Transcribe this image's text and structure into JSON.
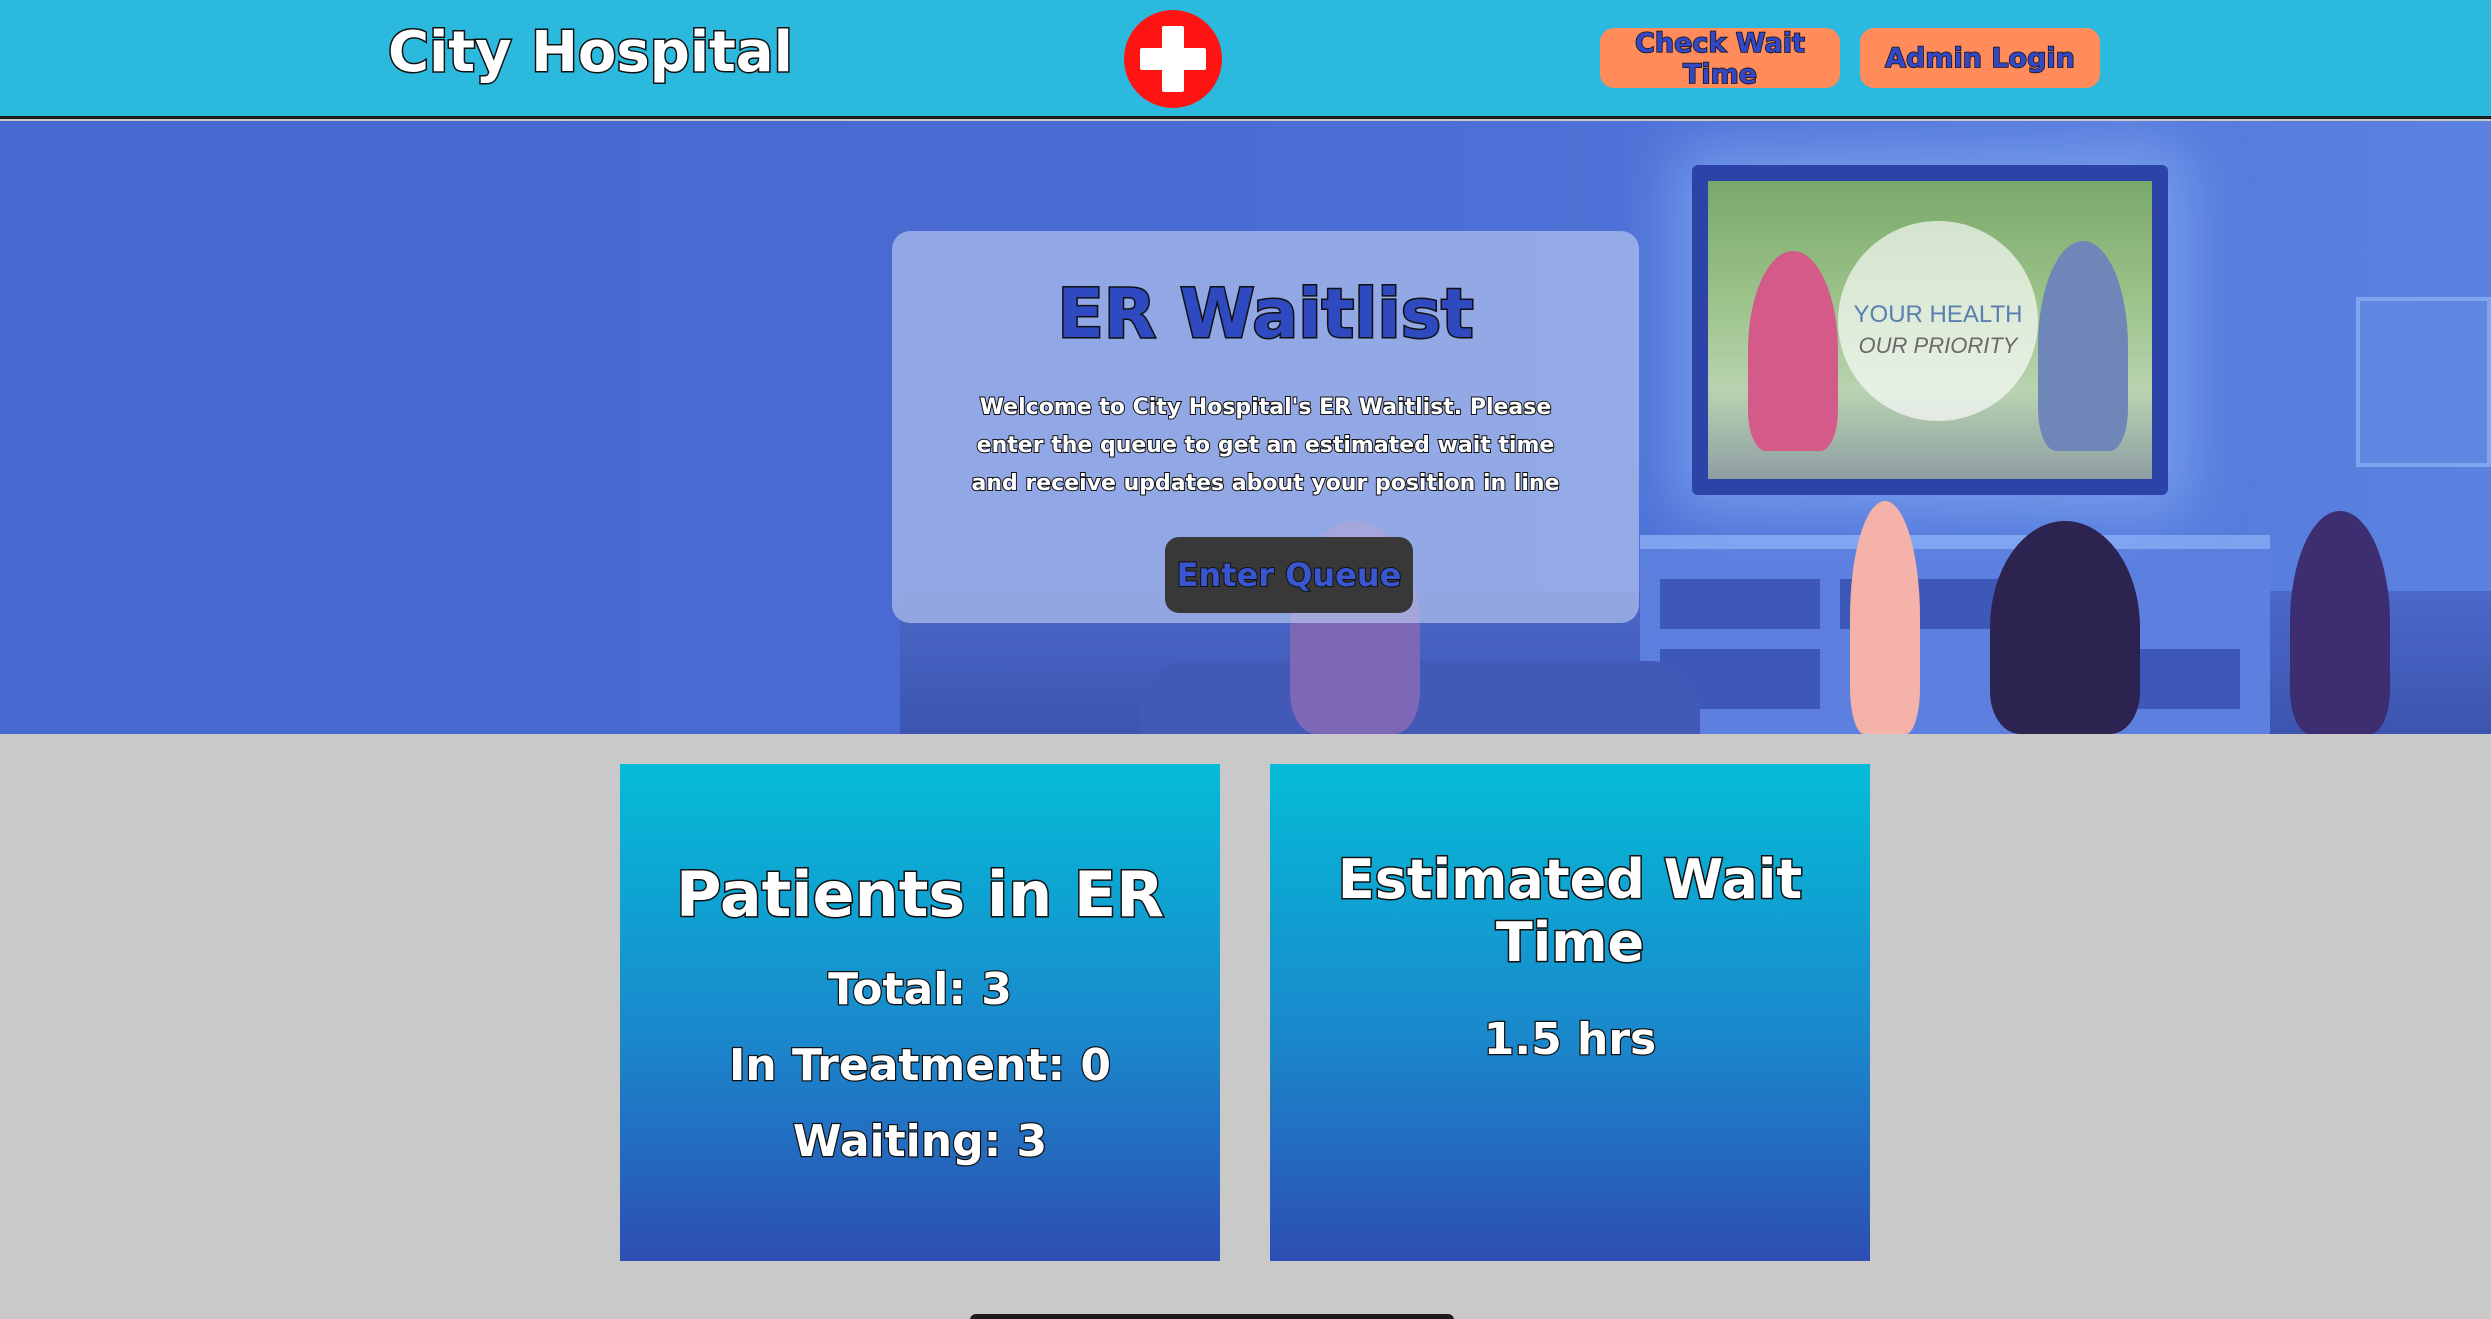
{
  "header": {
    "brand": "City Hospital",
    "check_wait_label": "Check Wait Time",
    "admin_login_label": "Admin Login"
  },
  "hero": {
    "title": "ER Waitlist",
    "description": "Welcome to City Hospital's ER Waitlist. Please enter the queue to get an estimated wait time and receive updates about your position in line",
    "enter_queue_label": "Enter Queue",
    "tv_line1": "YOUR HEALTH",
    "tv_line2": "OUR PRIORITY"
  },
  "patients": {
    "title": "Patients in ER",
    "total": "Total: 3",
    "in_treatment": "In Treatment: 0",
    "waiting": "Waiting: 3"
  },
  "wait_time": {
    "title": "Estimated Wait Time",
    "value": "1.5 hrs"
  },
  "colors": {
    "header_bg": "#2cb9de",
    "nav_button_bg": "#ff8c5a",
    "logo_red": "#ff1414",
    "hero_blue": "#4769cf",
    "page_bg": "#c9c9c9"
  },
  "icons": {
    "logo": "medical-cross-icon"
  }
}
